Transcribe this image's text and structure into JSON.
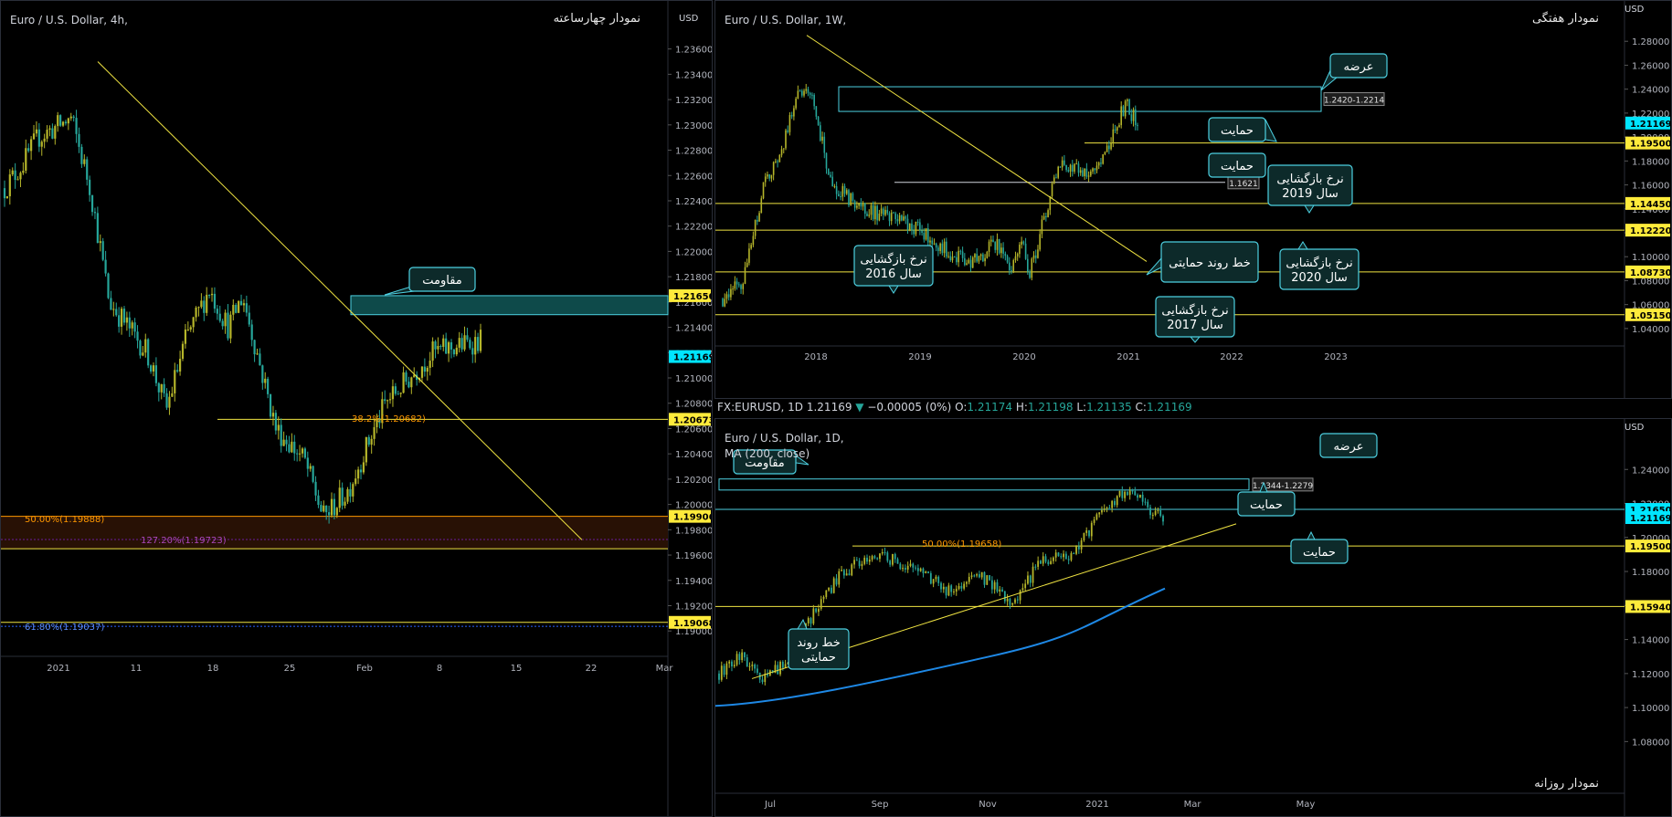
{
  "panels": {
    "left": {
      "title": "Euro / U.S. Dollar, 4h,",
      "name": "نمودار چهارساعته",
      "currency": "USD"
    },
    "weekly": {
      "title": "Euro / U.S. Dollar, 1W,",
      "name": "نمودار هفتگی",
      "currency": "USD"
    },
    "daily": {
      "title": "Euro / U.S. Dollar, 1D,",
      "ma_label": "MA (200, close)",
      "name": "نمودار روزانه",
      "currency": "USD"
    }
  },
  "daily_header": {
    "symbol": "FX:EURUSD, 1D",
    "last": "1.21169",
    "change": "−0.00005 (0%)",
    "o_label": "O:",
    "o": "1.21174",
    "h_label": "H:",
    "h": "1.21198",
    "l_label": "L:",
    "l": "1.21135",
    "c_label": "C:",
    "c": "1.21169"
  },
  "colors": {
    "background": "#000000",
    "up_candle": "#b5b52a",
    "down_candle": "#26a69a",
    "level_line": "#f0e442",
    "zone": "#0e4a4a",
    "zone_border": "#4dd0e1",
    "ma_line": "#1e88e5",
    "fib_orange": "#ff9800",
    "fib_purple": "#9c27b0",
    "fib_blue": "#2962ff",
    "label_bg_yellow": "#ffeb3b",
    "label_bg_cyan": "#00e5ff"
  },
  "chart_data": [
    {
      "id": "left",
      "type": "candlestick",
      "ylim": [
        1.1885,
        1.2385
      ],
      "x_ticks": [
        "2021",
        "11",
        "18",
        "25",
        "Feb",
        "8",
        "15",
        "22",
        "Mar"
      ],
      "y_ticks": [
        "1.23600",
        "1.23400",
        "1.23200",
        "1.23000",
        "1.22800",
        "1.22600",
        "1.22400",
        "1.22200",
        "1.22000",
        "1.21800",
        "1.21600",
        "1.21400",
        "1.21200",
        "1.21000",
        "1.20800",
        "1.20600",
        "1.20400",
        "1.20200",
        "1.20000",
        "1.19800",
        "1.19600",
        "1.19400",
        "1.19200",
        "1.19000"
      ],
      "price_labels": [
        {
          "text": "1.21650",
          "value": 1.2165,
          "style": "yellow"
        },
        {
          "text": "1.21169",
          "value": 1.21169,
          "style": "cyan"
        },
        {
          "text": "1.20673",
          "value": 1.20673,
          "style": "yellow"
        },
        {
          "text": "1.19906",
          "value": 1.19906,
          "style": "yellow"
        },
        {
          "text": "1.19068",
          "value": 1.19068,
          "style": "yellow"
        }
      ],
      "fib_labels": [
        {
          "text": "38.2%(1.20682)",
          "value": 1.20682,
          "color": "orange"
        },
        {
          "text": "50.00%(1.19888)",
          "value": 1.19888,
          "color": "orange"
        },
        {
          "text": "127.20%(1.19723)",
          "value": 1.19723,
          "color": "purple"
        },
        {
          "text": "61.80%(1.19037)",
          "value": 1.19037,
          "color": "blue"
        }
      ],
      "annotations": [
        {
          "text": "مقاومت"
        }
      ],
      "key_points": [
        {
          "date": "2020-12-31",
          "close": 1.2215
        },
        {
          "date": "2021-01-06",
          "close": 1.2345
        },
        {
          "date": "2021-01-18",
          "close": 1.2065
        },
        {
          "date": "2021-01-21",
          "close": 1.218
        },
        {
          "date": "2021-02-04",
          "close": 1.196
        },
        {
          "date": "2021-02-12",
          "close": 1.2125
        }
      ]
    },
    {
      "id": "weekly",
      "type": "candlestick",
      "ylim": [
        1.03,
        1.3
      ],
      "x_ticks": [
        "2018",
        "2019",
        "2020",
        "2021",
        "2022",
        "2023"
      ],
      "y_ticks": [
        "1.28000",
        "1.26000",
        "1.24000",
        "1.22000",
        "1.20000",
        "1.18000",
        "1.16000",
        "1.14000",
        "1.12000",
        "1.10000",
        "1.08000",
        "1.06000",
        "1.04000"
      ],
      "price_labels": [
        {
          "text": "1.21169",
          "value": 1.21169,
          "style": "cyan"
        },
        {
          "text": "1.19500",
          "value": 1.195,
          "style": "yellow"
        },
        {
          "text": "1.14450",
          "value": 1.1445,
          "style": "yellow"
        },
        {
          "text": "1.12220",
          "value": 1.1222,
          "style": "yellow"
        },
        {
          "text": "1.08730",
          "value": 1.0873,
          "style": "yellow"
        },
        {
          "text": "1.05150",
          "value": 1.0515,
          "style": "yellow"
        }
      ],
      "box_labels": [
        {
          "text": "1.2420-1.2214"
        },
        {
          "text": "1.1621"
        }
      ],
      "annotations": [
        {
          "text": "عرضه"
        },
        {
          "text": "حمایت"
        },
        {
          "text": "حمایت"
        },
        {
          "text": "نرخ بازگشایی سال 2019"
        },
        {
          "text": "خط روند حمایتی"
        },
        {
          "text": "نرخ بازگشایی سال 2016"
        },
        {
          "text": "نرخ بازگشایی سال 2020"
        },
        {
          "text": "نرخ بازگشایی سال 2017"
        }
      ],
      "key_points": [
        {
          "date": "2017-04",
          "close": 1.065
        },
        {
          "date": "2018-02",
          "close": 1.245
        },
        {
          "date": "2018-11",
          "close": 1.135
        },
        {
          "date": "2019-10",
          "close": 1.09
        },
        {
          "date": "2020-03",
          "close": 1.07
        },
        {
          "date": "2020-08",
          "close": 1.185
        },
        {
          "date": "2021-01",
          "close": 1.23
        },
        {
          "date": "2021-02",
          "close": 1.212
        }
      ]
    },
    {
      "id": "daily",
      "type": "candlestick",
      "ylim": [
        1.07,
        1.26
      ],
      "x_ticks": [
        "Jul",
        "Sep",
        "Nov",
        "2021",
        "Mar",
        "May"
      ],
      "y_ticks": [
        "1.24000",
        "1.22000",
        "1.20000",
        "1.18000",
        "1.16000",
        "1.14000",
        "1.12000",
        "1.10000",
        "1.08000"
      ],
      "price_labels": [
        {
          "text": "1.21650",
          "value": 1.2165,
          "style": "cyan"
        },
        {
          "text": "1.21169",
          "value": 1.21169,
          "style": "cyan"
        },
        {
          "text": "1.19500",
          "value": 1.195,
          "style": "yellow"
        },
        {
          "text": "1.15940",
          "value": 1.1594,
          "style": "yellow"
        }
      ],
      "box_labels": [
        {
          "text": "1.2344-1.2279"
        }
      ],
      "fib_labels": [
        {
          "text": "50.00%(1.19658)",
          "value": 1.19658,
          "color": "orange"
        }
      ],
      "annotations": [
        {
          "text": "عرضه"
        },
        {
          "text": "مقاومت"
        },
        {
          "text": "حمایت"
        },
        {
          "text": "حمایت"
        },
        {
          "text": "خط روند حمایتی"
        }
      ],
      "series": [
        {
          "name": "MA (200, close)",
          "key_points": [
            {
              "date": "2020-06",
              "value": 1.101
            },
            {
              "date": "2020-09",
              "value": 1.118
            },
            {
              "date": "2020-12",
              "value": 1.15
            },
            {
              "date": "2021-02",
              "value": 1.17
            }
          ]
        }
      ],
      "key_points": [
        {
          "date": "2020-06-15",
          "close": 1.125
        },
        {
          "date": "2020-08-31",
          "close": 1.195
        },
        {
          "date": "2020-11-04",
          "close": 1.165
        },
        {
          "date": "2021-01-06",
          "close": 1.232
        },
        {
          "date": "2021-02-12",
          "close": 1.212
        }
      ]
    }
  ]
}
